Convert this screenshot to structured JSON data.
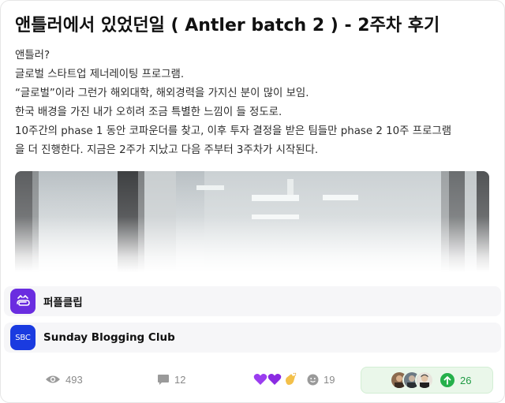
{
  "post": {
    "title": "앤틀러에서 있었던일 ( Antler batch 2 ) - 2주차 후기",
    "lines": [
      "앤틀러?",
      "글로벌 스타트업 제너레이팅 프로그램.",
      "“글로벌”이라 그런가 해외대학, 해외경력을 가지신 분이 많이 보임.",
      "한국 배경을 가진 내가 오히려 조금 특별한 느낌이 들 정도로.",
      "10주간의 phase 1 동안 코파운더를 찾고, 이후 투자 결정을 받은 팀들만 phase 2 10주 프로그램",
      "을 더 진행한다. 지금은 2주가 지났고 다음 주부터 3주차가 시작된다."
    ]
  },
  "communities": [
    {
      "name": "퍼플클립",
      "icon": "paperclip-icon",
      "color": "#6a2de0"
    },
    {
      "name": "Sunday Blogging Club",
      "icon": "sbc-logo",
      "logo_text": "SBC",
      "color": "#1a3be0"
    }
  ],
  "stats": {
    "views": "493",
    "comments": "12",
    "reactions": "19",
    "reaction_emojis": [
      "purple-heart",
      "purple-heart",
      "clapping-hands"
    ],
    "upvotes": "26"
  },
  "colors": {
    "accent_green": "#25b04b",
    "upvote_bg": "#eaf7ea"
  }
}
